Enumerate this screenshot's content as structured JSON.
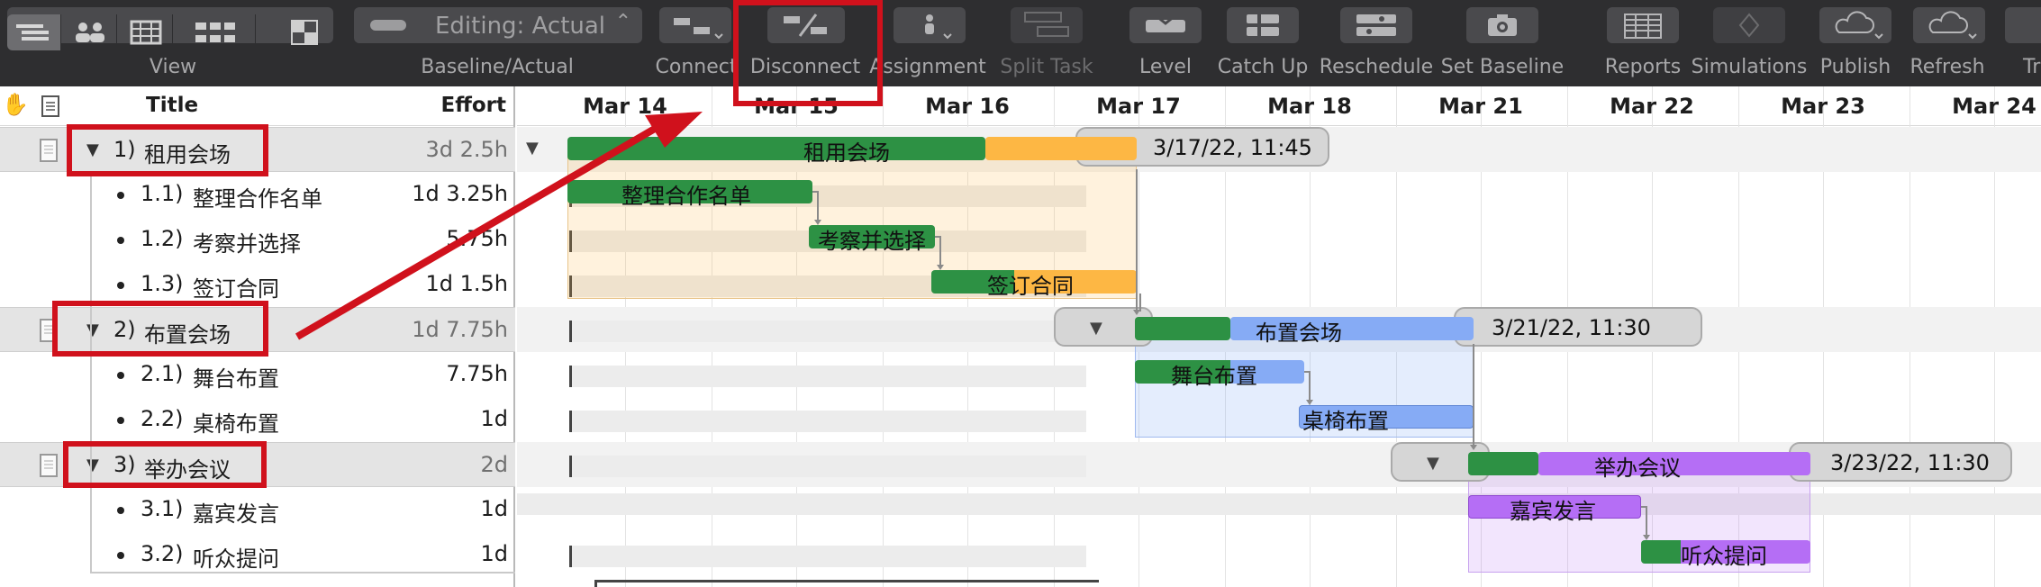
{
  "toolbar": {
    "view_label": "View",
    "baseline_label": "Baseline/Actual",
    "baseline_value": "Editing: Actual",
    "connect_label": "Connect",
    "disconnect_label": "Disconnect",
    "assignment_label": "Assignment",
    "split_label": "Split Task",
    "level_label": "Level",
    "catchup_label": "Catch Up",
    "reschedule_label": "Reschedule",
    "setbaseline_label": "Set Baseline",
    "reports_label": "Reports",
    "simulations_label": "Simulations",
    "publish_label": "Publish",
    "refresh_label": "Refresh",
    "track_label": "Trac"
  },
  "outline": {
    "col_title": "Title",
    "col_effort": "Effort",
    "rows": [
      {
        "num": "1)",
        "title": "租用会场",
        "effort": "3d 2.5h"
      },
      {
        "num": "1.1)",
        "title": "整理合作名单",
        "effort": "1d 3.25h"
      },
      {
        "num": "1.2)",
        "title": "考察并选择",
        "effort": "5.75h"
      },
      {
        "num": "1.3)",
        "title": "签订合同",
        "effort": "1d 1.5h"
      },
      {
        "num": "2)",
        "title": "布置会场",
        "effort": "1d 7.75h"
      },
      {
        "num": "2.1)",
        "title": "舞台布置",
        "effort": "7.75h"
      },
      {
        "num": "2.2)",
        "title": "桌椅布置",
        "effort": "1d"
      },
      {
        "num": "3)",
        "title": "举办会议",
        "effort": "2d"
      },
      {
        "num": "3.1)",
        "title": "嘉宾发言",
        "effort": "1d"
      },
      {
        "num": "3.2)",
        "title": "听众提问",
        "effort": "1d"
      }
    ]
  },
  "gantt": {
    "dates": [
      "Mar 14",
      "Mar 15",
      "Mar 16",
      "Mar 17",
      "Mar 18",
      "Mar 21",
      "Mar 22",
      "Mar 23",
      "Mar 24"
    ],
    "group_end_labels": [
      "3/17/22, 11:45",
      "3/21/22, 11:30",
      "3/23/22, 11:30"
    ]
  },
  "colors": {
    "green": "#2d9144",
    "orange": "#fdb744",
    "blue": "#86abf5",
    "purple": "#b56ef5",
    "highlight": "#d0111c"
  }
}
